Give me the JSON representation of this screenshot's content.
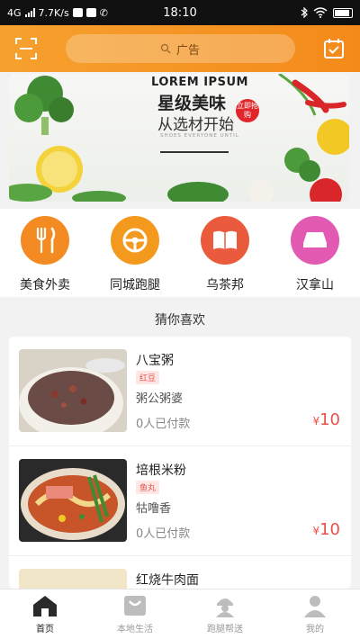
{
  "status_bar": {
    "network": "4G",
    "speed": "7.7K/s",
    "time": "18:10"
  },
  "header": {
    "search_placeholder": "广告"
  },
  "banner": {
    "title_en": "LOREM IPSUM",
    "title_zh": "星级美味",
    "subtitle_zh": "从选材开始",
    "small_text": "SHOES EVERYONE UNTIL",
    "badge": "立即抢购"
  },
  "categories": [
    {
      "label": "美食外卖",
      "icon": "fork-knife-icon",
      "color": "#f38a22"
    },
    {
      "label": "同城跑腿",
      "icon": "steering-wheel-icon",
      "color": "#f39a1e"
    },
    {
      "label": "乌茶邦",
      "icon": "book-icon",
      "color": "#ea5a3d"
    },
    {
      "label": "汉拿山",
      "icon": "sofa-icon",
      "color": "#e25ab2"
    }
  ],
  "recommend": {
    "title": "猜你喜欢",
    "items": [
      {
        "name": "八宝粥",
        "tag": "红豆",
        "shop": "粥公粥婆",
        "sold": "0人已付款",
        "currency": "¥",
        "price": "10"
      },
      {
        "name": "培根米粉",
        "tag": "鱼丸",
        "shop": "牯噜香",
        "sold": "0人已付款",
        "currency": "¥",
        "price": "10"
      },
      {
        "name": "红烧牛肉面",
        "tag": "",
        "shop": "",
        "sold": "",
        "currency": "",
        "price": ""
      }
    ]
  },
  "tabs": [
    {
      "label": "首页",
      "icon": "home-icon",
      "active": true
    },
    {
      "label": "本地生活",
      "icon": "shopping-bag-icon",
      "active": false
    },
    {
      "label": "跑腿帮送",
      "icon": "courier-icon",
      "active": false
    },
    {
      "label": "我的",
      "icon": "user-icon",
      "active": false
    }
  ],
  "colors": {
    "brand": "#f48a1a",
    "price": "#e8504b"
  }
}
